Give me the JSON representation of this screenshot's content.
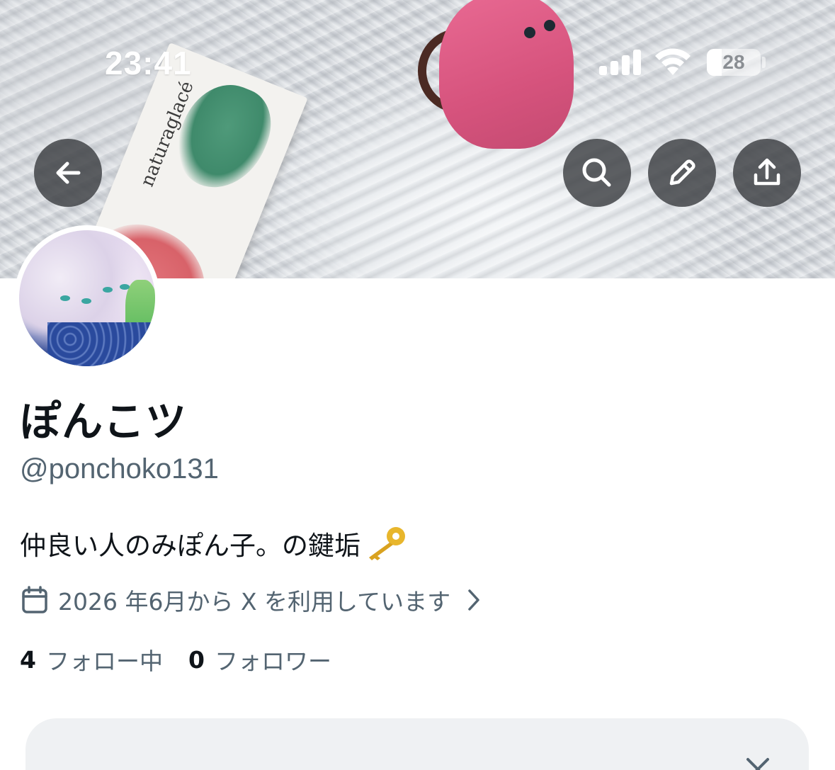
{
  "status_bar": {
    "time": "23:41",
    "battery_level": "28",
    "battery_fraction": 0.28,
    "icons": [
      "cellular-signal-icon",
      "wifi-icon",
      "battery-icon"
    ]
  },
  "header": {
    "buttons": [
      "back-arrow-icon",
      "search-icon",
      "edit-pencil-icon",
      "share-upload-icon"
    ]
  },
  "banner": {
    "lipstick_box_text": "naturaglacé"
  },
  "profile": {
    "display_name": "ぽんこツ",
    "handle": "@ponchoko131",
    "bio": "仲良い人のみぽん子。の鍵垢",
    "bio_emoji_icon": "key-icon",
    "joined": "2026 年6月から X を利用しています",
    "following_count": "4",
    "following_label": "フォロー中",
    "followers_count": "0",
    "followers_label": "フォロワー"
  },
  "colors": {
    "primary_text": "#0f1419",
    "secondary_text": "#536471",
    "card_background": "#eff1f3",
    "header_button_bg": "#3c3e42"
  }
}
